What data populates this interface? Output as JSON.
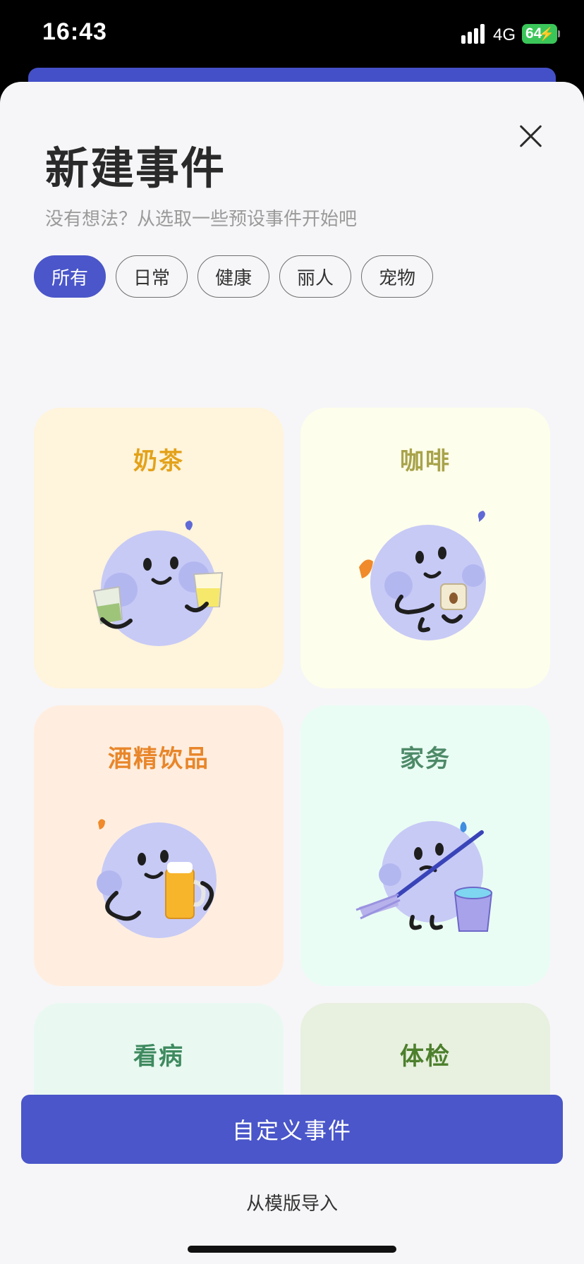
{
  "status_bar": {
    "time": "16:43",
    "network": "4G",
    "battery": "64"
  },
  "sheet": {
    "title": "新建事件",
    "subtitle": "没有想法？从选取一些预设事件开始吧",
    "close_icon": "close-icon"
  },
  "tabs": [
    {
      "label": "所有",
      "active": true
    },
    {
      "label": "日常",
      "active": false
    },
    {
      "label": "健康",
      "active": false
    },
    {
      "label": "丽人",
      "active": false
    },
    {
      "label": "宠物",
      "active": false
    }
  ],
  "cards": [
    {
      "title": "奶茶",
      "bg": "#fff4dc",
      "color": "#e3a21a",
      "illustration": "milk-tea-illustration"
    },
    {
      "title": "咖啡",
      "bg": "#fefeec",
      "color": "#a8a34a",
      "illustration": "coffee-illustration"
    },
    {
      "title": "酒精饮品",
      "bg": "#ffeee0",
      "color": "#e8862a",
      "illustration": "beer-illustration"
    },
    {
      "title": "家务",
      "bg": "#eafdf4",
      "color": "#4e8a68",
      "illustration": "housework-illustration"
    },
    {
      "title": "看病",
      "bg": "#e9f9f1",
      "color": "#3f8a60",
      "illustration": "doctor-illustration"
    },
    {
      "title": "体检",
      "bg": "#e8f0e0",
      "color": "#4c7f2c",
      "illustration": "checkup-illustration"
    }
  ],
  "actions": {
    "primary": "自定义事件",
    "secondary": "从模版导入"
  },
  "colors": {
    "accent": "#4a56c9",
    "character": "#c7caf5",
    "ink": "#1e1e1e"
  }
}
